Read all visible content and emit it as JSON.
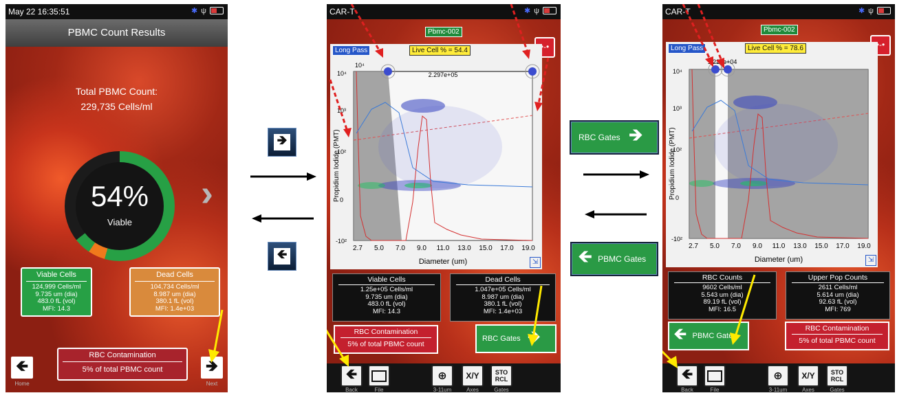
{
  "panel1": {
    "status_time": "May 22 16:35:51",
    "title": "PBMC Count Results",
    "total_label": "Total PBMC Count:",
    "total_value": "229,735 Cells/ml",
    "percent": "54%",
    "percent_label": "Viable",
    "viable_fraction": 0.54,
    "viable_card": {
      "title": "Viable Cells",
      "l1": "124,999 Cells/ml",
      "l2": "9.735 um (dia)",
      "l3": "483.0 fL (vol)",
      "l4": "MFI: 14.3"
    },
    "dead_card": {
      "title": "Dead Cells",
      "l1": "104,734 Cells/ml",
      "l2": "8.987 um (dia)",
      "l3": "380.1 fL (vol)",
      "l4": "MFI: 1.4e+03"
    },
    "rbc": {
      "title": "RBC Contamination",
      "value": "5% of total PBMC count"
    },
    "home_label": "Home",
    "next_label": "Next",
    "colors": {
      "viable": "#27a045",
      "dead_card": "#d98a3c",
      "orange": "#f07a1c",
      "rbc": "#a8232c"
    }
  },
  "panel2": {
    "status_title": "CAR-T",
    "sample": "Pbmc-002",
    "long_pass": "Long Pass",
    "live_pct": "Live Cell % = 54.4",
    "gate_value": "2.297e+05",
    "ylabel": "Propidium Iodide (PMT)",
    "xlabel": "Diameter (um)",
    "xticks": [
      "2.7",
      "5.0",
      "7.0",
      "9.0",
      "11.0",
      "13.0",
      "15.0",
      "17.0",
      "19.0"
    ],
    "viable": {
      "title": "Viable Cells",
      "l1": "1.25e+05 Cells/ml",
      "l2": "9.735 um (dia)",
      "l3": "483.0 fL (vol)",
      "l4": "MFI: 14.3"
    },
    "dead": {
      "title": "Dead Cells",
      "l1": "1.047e+05 Cells/ml",
      "l2": "8.987 um (dia)",
      "l3": "380.1 fL (vol)",
      "l4": "MFI: 1.4e+03"
    },
    "rbc": {
      "title": "RBC Contamination",
      "value": "5% of total PBMC count"
    },
    "rbc_gates_btn": "RBC Gates",
    "toolbar": {
      "back": "Back",
      "file": "File",
      "zoom": "3-11um",
      "axes": "Axes",
      "gates": "Gates",
      "xy": "X/Y",
      "sto": "STO",
      "rcl": "RCL"
    }
  },
  "panel3": {
    "status_title": "CAR-T",
    "sample": "Pbmc-002",
    "long_pass": "Long Pass",
    "live_pct": "Live Cell % = 78.6",
    "gate_value": "1.221e+04",
    "ylabel": "Propidium Iodide (PMT)",
    "xlabel": "Diameter (um)",
    "xticks": [
      "2.7",
      "5.0",
      "7.0",
      "9.0",
      "11.0",
      "13.0",
      "15.0",
      "17.0",
      "19.0"
    ],
    "rbc_counts": {
      "title": "RBC Counts",
      "l1": "9602 Cells/ml",
      "l2": "5.543 um (dia)",
      "l3": "89.19 fL (vol)",
      "l4": "MFI: 16.5"
    },
    "upper": {
      "title": "Upper Pop Counts",
      "l1": "2611 Cells/ml",
      "l2": "5.614 um (dia)",
      "l3": "92.63 fL (vol)",
      "l4": "MFI: 769"
    },
    "rbc": {
      "title": "RBC Contamination",
      "value": "5% of total PBMC count"
    },
    "pbmc_gates_btn": "PBMC Gates",
    "toolbar": {
      "back": "Back",
      "file": "File",
      "zoom": "3-11um",
      "axes": "Axes",
      "gates": "Gates",
      "xy": "X/Y",
      "sto": "STO",
      "rcl": "RCL"
    }
  },
  "middle": {
    "rbc_gates": "RBC Gates",
    "pbmc_gates": "PBMC Gates"
  }
}
